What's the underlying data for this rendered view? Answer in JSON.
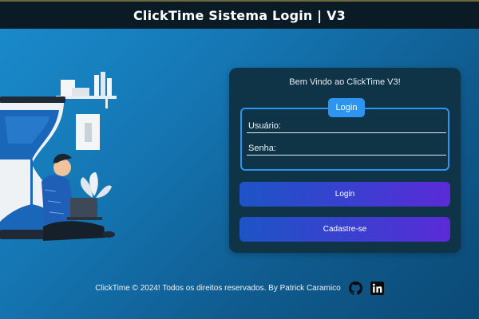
{
  "header": {
    "title": "ClickTime Sistema Login | V3"
  },
  "card": {
    "welcome": "Bem Vindo ao ClickTime V3!",
    "legend": "Login",
    "username_placeholder": "Usuário:",
    "password_placeholder": "Senha:",
    "login_button": "Login",
    "signup_button": "Cadastre-se"
  },
  "footer": {
    "text": "ClickTime © 2024! Todos os direitos reservados. By Patrick Caramico",
    "icons": [
      "github-icon",
      "linkedin-icon"
    ]
  },
  "colors": {
    "topbar": "#0a1b26",
    "card": "#0f3347",
    "accent": "#2d95f0",
    "button_start": "#1d54c6",
    "button_end": "#5b2ad8"
  }
}
